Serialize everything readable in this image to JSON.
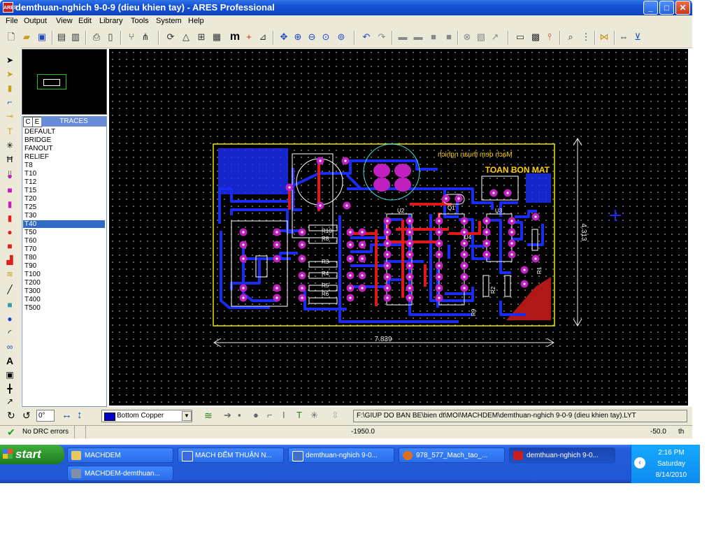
{
  "window": {
    "title": "demthuan-nghich 9-0-9 (dieu khien tay) - ARES Professional",
    "icon_label": "ARES"
  },
  "menu": [
    "File",
    "Output",
    "View",
    "Edit",
    "Library",
    "Tools",
    "System",
    "Help"
  ],
  "toolbar": {
    "icons": [
      "new-icon",
      "open-icon",
      "save-icon",
      "import-icon",
      "export-icon",
      "print-icon",
      "print-area-icon",
      "library-icon",
      "netlist-icon",
      "refresh-icon",
      "board-icon",
      "grid-icon",
      "layers-icon",
      "metric-icon",
      "origin-icon",
      "pointer-coord-icon",
      "pan-icon",
      "zoom-in-icon",
      "zoom-out-icon",
      "zoom-all-icon",
      "zoom-area-icon",
      "undo-icon",
      "redo-icon",
      "block-copy-icon",
      "block-move-icon",
      "block-rotate-icon",
      "block-delete-icon",
      "pick-part-icon",
      "make-package-icon",
      "decompose-icon",
      "connectivity-icon",
      "design-rule-icon",
      "autoplacer-icon",
      "search-icon",
      "autorouter-icon",
      "power-plane-icon",
      "drc-icon"
    ],
    "metric_label": "m"
  },
  "overview": {
    "board_color": "#22c022"
  },
  "selector": {
    "tab_c": "C",
    "tab_e": "E",
    "title": "TRACES",
    "items": [
      "DEFAULT",
      "BRIDGE",
      "FANOUT",
      "RELIEF",
      "T8",
      "T10",
      "T12",
      "T15",
      "T20",
      "T25",
      "T30",
      "T40",
      "T50",
      "T60",
      "T70",
      "T80",
      "T90",
      "T100",
      "T200",
      "T300",
      "T400",
      "T500"
    ],
    "selected": "T40"
  },
  "board": {
    "title_line1": "Mach dem thuan nghich",
    "title_line2": "TOAN BON MAT",
    "width_dim": "7.839",
    "height_dim": "4.313",
    "resistor_labels": [
      "R10",
      "R8",
      "R3",
      "R4",
      "R5",
      "R6",
      "R1",
      "R2",
      "R9"
    ],
    "ic_labels": [
      "U2",
      "U4",
      "U3",
      "Q1"
    ],
    "colors": {
      "outline": "#e8e800",
      "bottom_copper": "#1a2cf0",
      "top_copper": "#e01818",
      "pad": "#c020c0",
      "silk": "#ffffff",
      "dimension": "#f0f0f0"
    }
  },
  "bottom": {
    "rotation_value": "0°",
    "layer": "Bottom Copper",
    "layer_color": "#0000c8",
    "path": "F:\\GIUP DO BAN BE\\bien dt\\MOI\\MACHDEM\\demthuan-nghich 9-0-9 (dieu khien tay).LYT"
  },
  "status": {
    "drc": "No DRC errors",
    "x_coord": "-1950.0",
    "y_coord": "-50.0",
    "units": "th"
  },
  "taskbar": {
    "start_label": "start",
    "tasks": [
      {
        "label": "MACHDEM",
        "color": "#e8c860"
      },
      {
        "label": "MACH ĐẾM THUẬN N...",
        "color": "#3a6ae0"
      },
      {
        "label": "demthuan-nghich 9-0...",
        "color": "#4070c8"
      },
      {
        "label": "978_577_Mach_tao_...",
        "color": "#e07020"
      },
      {
        "label": "demthuan-nghich 9-0...",
        "color": "#c62020"
      },
      {
        "label": "MACHDEM-demthuan...",
        "color": "#8090a8"
      }
    ],
    "time": "2:16 PM",
    "day": "Saturday",
    "date": "8/14/2010"
  }
}
